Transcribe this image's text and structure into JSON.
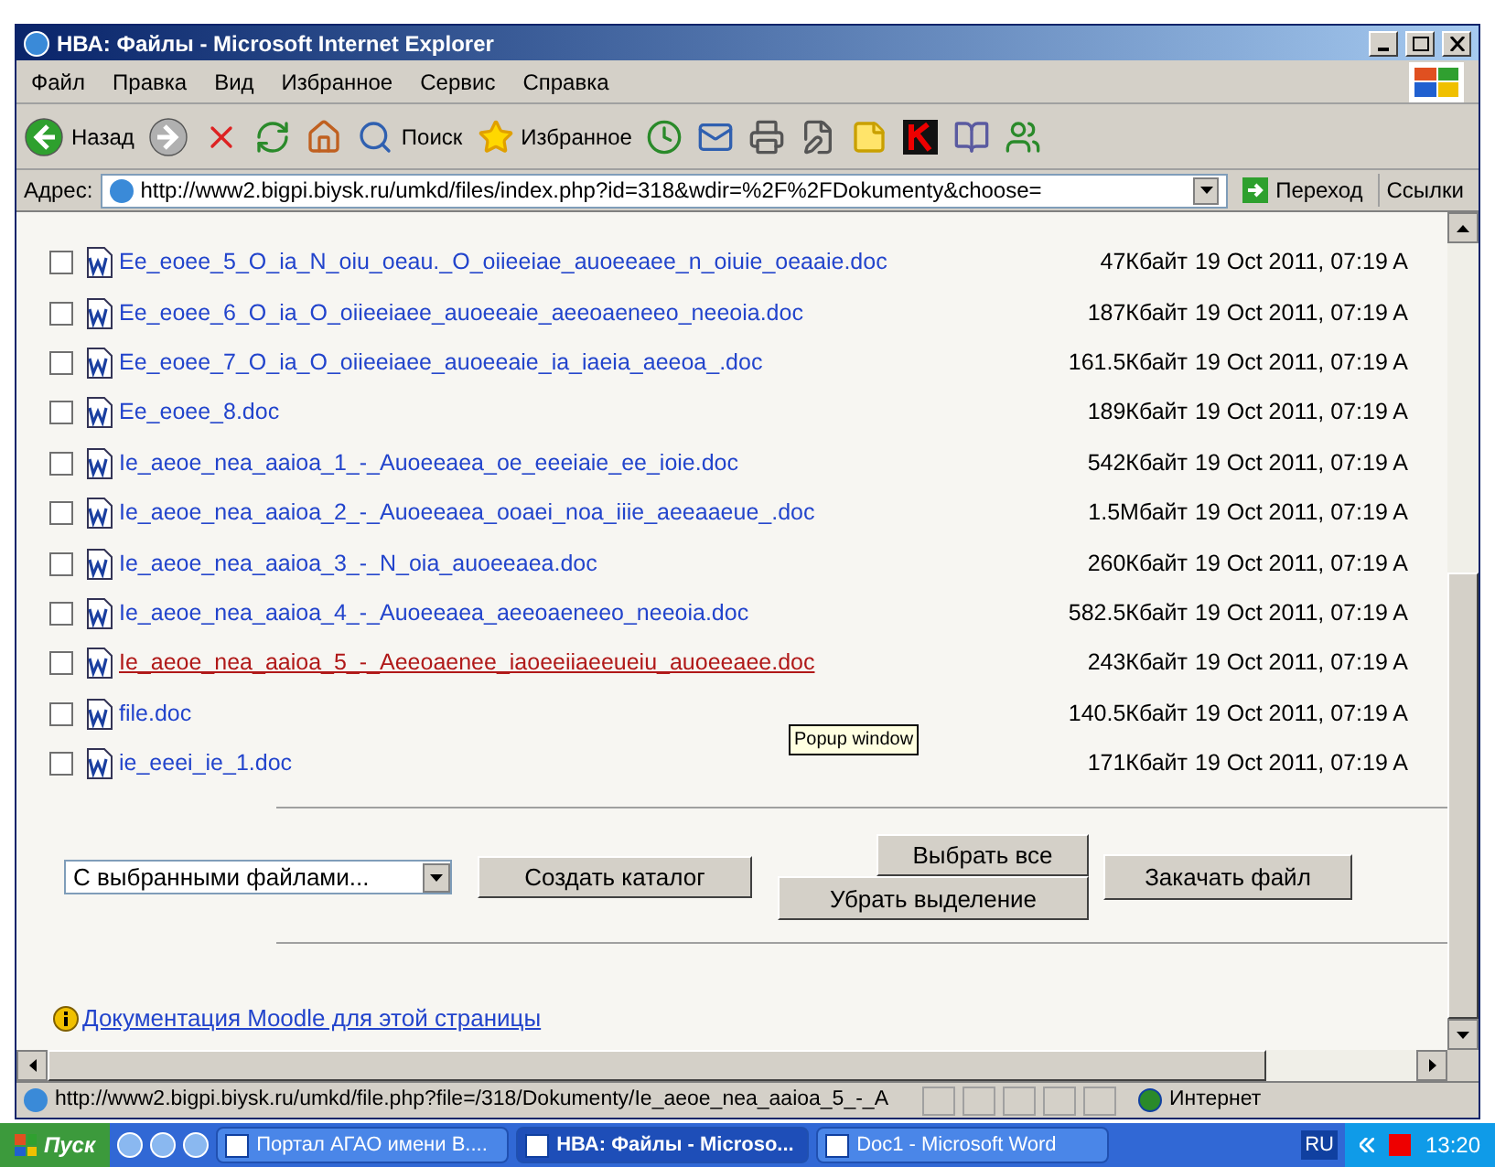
{
  "window": {
    "title": "НВА: Файлы - Microsoft Internet Explorer"
  },
  "menu": [
    "Файл",
    "Правка",
    "Вид",
    "Избранное",
    "Сервис",
    "Справка"
  ],
  "toolbar": [
    {
      "kind": "back",
      "label": "Назад"
    },
    {
      "kind": "forward"
    },
    {
      "kind": "stop"
    },
    {
      "kind": "refresh"
    },
    {
      "kind": "home"
    },
    {
      "kind": "search",
      "label": "Поиск"
    },
    {
      "kind": "favorites",
      "label": "Избранное"
    },
    {
      "kind": "history"
    },
    {
      "kind": "mail"
    },
    {
      "kind": "print"
    },
    {
      "kind": "edit"
    },
    {
      "kind": "note"
    },
    {
      "kind": "antivirus"
    },
    {
      "kind": "research"
    },
    {
      "kind": "messenger"
    }
  ],
  "address_bar": {
    "label": "Адрес:",
    "value": "http://www2.bigpi.biysk.ru/umkd/files/index.php?id=318&wdir=%2F%2FDokumenty&choose=",
    "go": "Переход",
    "links": "Ссылки"
  },
  "files": [
    {
      "name": "Ee_eoee_5_O_ia_N_oiu_oeau._O_oiieeiae_auoeeaee_n_oiuie_oeaaie.doc",
      "size": "47Кбайт",
      "date": "19 Oct 2011, 07:19 A",
      "checked": false,
      "hovered": false
    },
    {
      "name": "Ee_eoee_6_O_ia_O_oiieeiaee_auoeeaie_aeeoaeneeo_neeoia.doc",
      "size": "187Кбайт",
      "date": "19 Oct 2011, 07:19 A",
      "checked": false,
      "hovered": false
    },
    {
      "name": "Ee_eoee_7_O_ia_O_oiieeiaee_auoeeaie_ia_iaeia_aeeoa_.doc",
      "size": "161.5Кбайт",
      "date": "19 Oct 2011, 07:19 A",
      "checked": false,
      "hovered": false
    },
    {
      "name": "Ee_eoee_8.doc",
      "size": "189Кбайт",
      "date": "19 Oct 2011, 07:19 A",
      "checked": false,
      "hovered": false
    },
    {
      "name": "Ie_aeoe_nea_aaioa_1_-_Auoeeaea_oe_eeeiaie_ee_ioie.doc",
      "size": "542Кбайт",
      "date": "19 Oct 2011, 07:19 A",
      "checked": false,
      "hovered": false
    },
    {
      "name": "Ie_aeoe_nea_aaioa_2_-_Auoeeaea_ooaei_noa_iiie_aeeaaeue_.doc",
      "size": "1.5Мбайт",
      "date": "19 Oct 2011, 07:19 A",
      "checked": false,
      "hovered": false
    },
    {
      "name": "Ie_aeoe_nea_aaioa_3_-_N_oia_auoeeaea.doc",
      "size": "260Кбайт",
      "date": "19 Oct 2011, 07:19 A",
      "checked": false,
      "hovered": false
    },
    {
      "name": "Ie_aeoe_nea_aaioa_4_-_Auoeeaea_aeeoaeneeo_neeoia.doc",
      "size": "582.5Кбайт",
      "date": "19 Oct 2011, 07:19 A",
      "checked": false,
      "hovered": false
    },
    {
      "name": "Ie_aeoe_nea_aaioa_5_-_Aeeoaenee_iaoeeiiaeeueiu_auoeeaee.doc",
      "size": "243Кбайт",
      "date": "19 Oct 2011, 07:19 A",
      "checked": false,
      "hovered": true
    },
    {
      "name": "file.doc",
      "size": "140.5Кбайт",
      "date": "19 Oct 2011, 07:19 A",
      "checked": false,
      "hovered": false
    },
    {
      "name": "ie_eeei_ie_1.doc",
      "size": "171Кбайт",
      "date": "19 Oct 2011, 07:19 A",
      "checked": false,
      "hovered": false
    }
  ],
  "tooltip": "Popup window",
  "actions": {
    "with_selected": "С выбранными файлами...",
    "create_folder": "Создать каталог",
    "select_all": "Выбрать все",
    "deselect": "Убрать выделение",
    "upload": "Закачать файл"
  },
  "help_link": "Документация Moodle для этой страницы",
  "status_bar": {
    "url": "http://www2.bigpi.biysk.ru/umkd/file.php?file=/318/Dokumenty/Ie_aeoe_nea_aaioa_5_-_A",
    "zone": "Интернет"
  },
  "taskbar": {
    "start": "Пуск",
    "tasks": [
      {
        "label": "Портал АГАО имени В....",
        "selected": false
      },
      {
        "label": "НВА: Файлы - Microso...",
        "selected": true
      },
      {
        "label": "Doc1 - Microsoft Word",
        "selected": false
      }
    ],
    "language": "RU",
    "clock": "13:20"
  }
}
